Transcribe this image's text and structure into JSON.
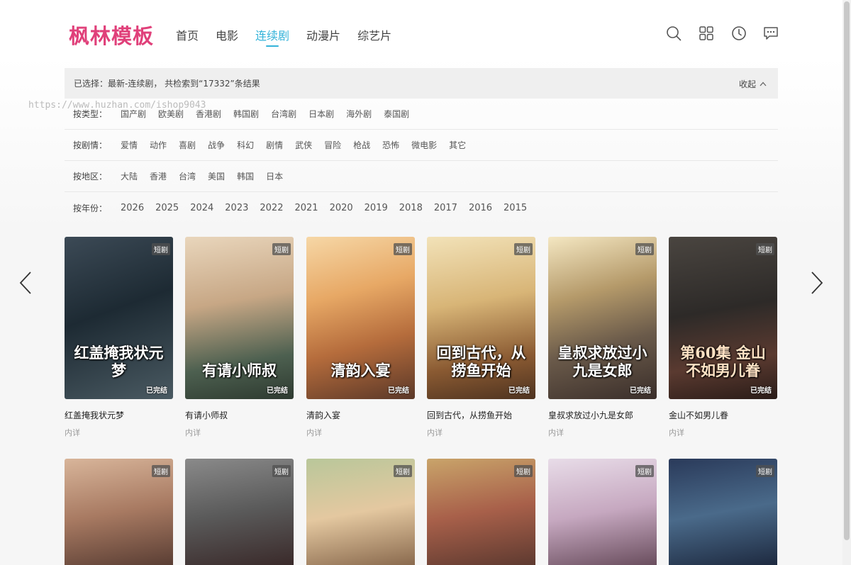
{
  "header": {
    "logo": "枫林模板",
    "nav": [
      "首页",
      "电影",
      "连续剧",
      "动漫片",
      "综艺片"
    ],
    "active_nav": "连续剧",
    "icons": [
      "search-icon",
      "grid-icon",
      "history-icon",
      "message-icon"
    ]
  },
  "filter": {
    "selected_text": "已选择：最新-连续剧， 共检索到“17332”条结果",
    "collapse_label": "收起",
    "rows": [
      {
        "label": "按类型：",
        "items": [
          "国产剧",
          "欧美剧",
          "香港剧",
          "韩国剧",
          "台湾剧",
          "日本剧",
          "海外剧",
          "泰国剧"
        ]
      },
      {
        "label": "按剧情：",
        "items": [
          "爱情",
          "动作",
          "喜剧",
          "战争",
          "科幻",
          "剧情",
          "武侠",
          "冒险",
          "枪战",
          "恐怖",
          "微电影",
          "其它"
        ]
      },
      {
        "label": "按地区：",
        "items": [
          "大陆",
          "香港",
          "台湾",
          "美国",
          "韩国",
          "日本"
        ]
      },
      {
        "label": "按年份：",
        "items": [
          "2026",
          "2025",
          "2024",
          "2023",
          "2022",
          "2021",
          "2020",
          "2019",
          "2018",
          "2017",
          "2016",
          "2015"
        ]
      }
    ]
  },
  "watermark": "https://www.huzhan.com/ishop9043",
  "cards_row1": [
    {
      "title": "红盖掩我状元梦",
      "sub": "内详",
      "badge": "短剧",
      "poster_text": "红盖掩我状元梦",
      "status": "已完结"
    },
    {
      "title": "有请小师叔",
      "sub": "内详",
      "badge": "短剧",
      "poster_text": "有请小师叔",
      "status": "已完结"
    },
    {
      "title": "清韵入宴",
      "sub": "内详",
      "badge": "短剧",
      "poster_text": "清韵入宴",
      "status": "已完结"
    },
    {
      "title": "回到古代，从捞鱼开始",
      "sub": "内详",
      "badge": "短剧",
      "poster_text": "回到古代，从捞鱼开始",
      "status": "已完结"
    },
    {
      "title": "皇叔求放过小九是女郎",
      "sub": "内详",
      "badge": "短剧",
      "poster_text": "皇叔求放过小九是女郎",
      "status": "已完结"
    },
    {
      "title": "金山不如男儿眷",
      "sub": "内详",
      "badge": "短剧",
      "poster_text": "第60集 金山不如男儿眷",
      "status": "已完结"
    }
  ],
  "cards_row2": [
    {
      "badge": "短剧"
    },
    {
      "badge": "短剧"
    },
    {
      "badge": "短剧"
    },
    {
      "badge": "短剧"
    },
    {
      "badge": "短剧"
    },
    {
      "badge": "短剧"
    }
  ],
  "colors": {
    "brand": "#e0407a",
    "accent": "#34b3d9"
  }
}
